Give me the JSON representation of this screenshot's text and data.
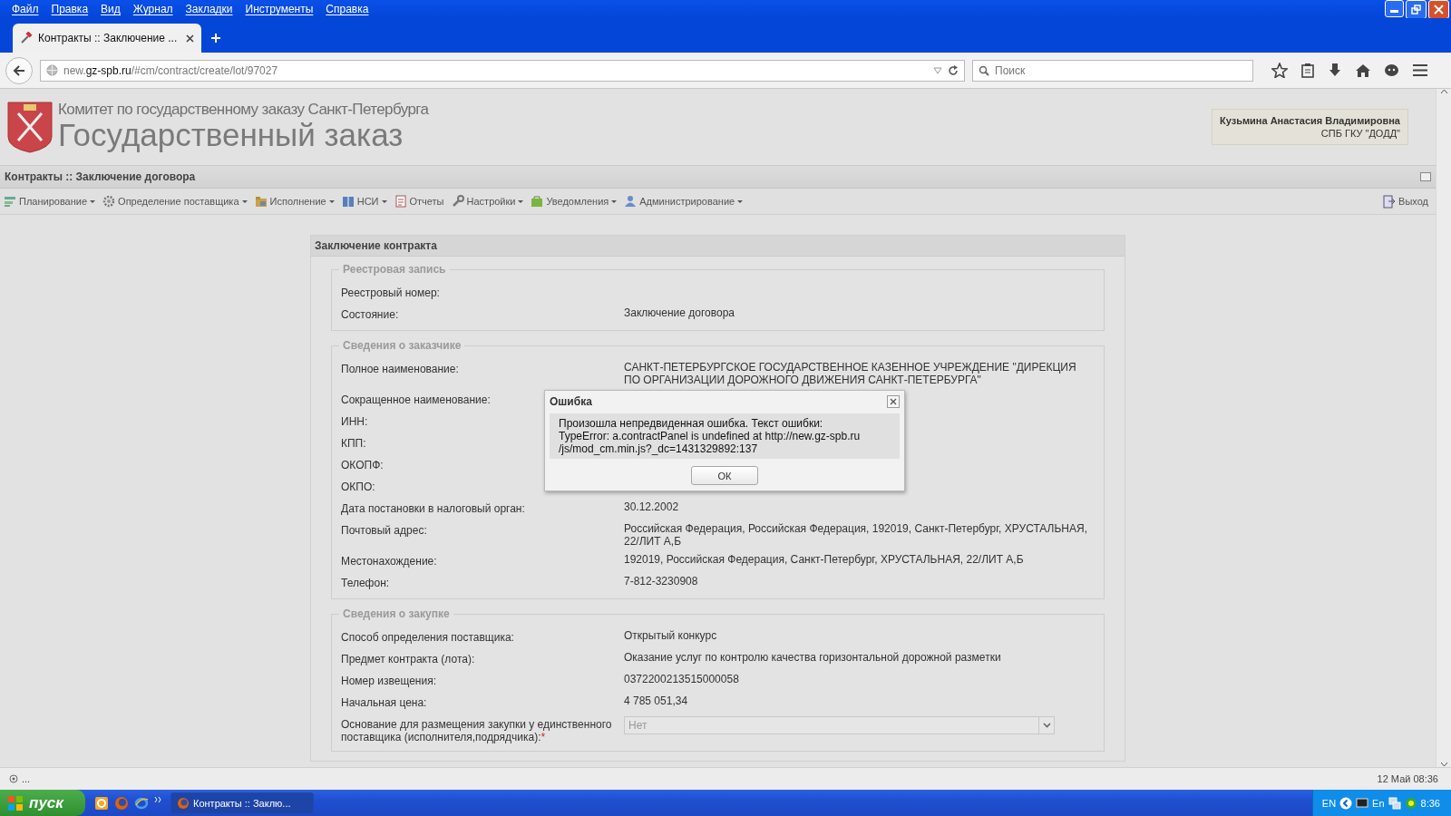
{
  "browser": {
    "menu": [
      "Файл",
      "Правка",
      "Вид",
      "Журнал",
      "Закладки",
      "Инструменты",
      "Справка"
    ],
    "tabs": [
      {
        "title": "Контракты :: Заключение ..."
      }
    ],
    "address": "new.**gz-spb.ru**/#cm/contract/create/lot/97027",
    "search": {
      "placeholder": "Поиск"
    }
  },
  "header": {
    "org": "Комитет по государственному заказу Санкт-Петербурга",
    "title": "Государственный заказ",
    "user": {
      "name": "Кузьмина Анастасия Владимировна",
      "org": "СПБ ГКУ \"ДОДД\""
    }
  },
  "panel": {
    "title": "Контракты :: Заключение договора"
  },
  "toolbar": {
    "items": [
      {
        "label": "Планирование",
        "kind": "plan",
        "dropdown": true
      },
      {
        "label": "Определение поставщика",
        "kind": "gears",
        "dropdown": true
      },
      {
        "label": "Исполнение",
        "kind": "folder",
        "dropdown": true
      },
      {
        "label": "НСИ",
        "kind": "book",
        "dropdown": true
      },
      {
        "label": "Отчеты",
        "kind": "report",
        "dropdown": false
      },
      {
        "label": "Настройки",
        "kind": "wrench",
        "dropdown": true
      },
      {
        "label": "Уведомления",
        "kind": "bag",
        "dropdown": true
      },
      {
        "label": "Администрирование",
        "kind": "user",
        "dropdown": true
      }
    ],
    "logout": "Выход"
  },
  "form": {
    "title": "Заключение контракта",
    "sections": [
      {
        "legend": "Реестровая запись",
        "fields": [
          {
            "label": "Реестровый номер:",
            "kind": "text"
          },
          {
            "label": "Состояние:",
            "kind": "text",
            "value": "Заключение договора"
          }
        ]
      },
      {
        "legend": "Сведения о заказчике",
        "fields": [
          {
            "label": "Полное наименование:",
            "kind": "text",
            "value": "САНКТ-ПЕТЕРБУРГСКОЕ ГОСУДАРСТВЕННОЕ КАЗЕННОЕ УЧРЕЖДЕНИЕ \"ДИРЕКЦИЯ ПО ОРГАНИЗАЦИИ ДОРОЖНОГО ДВИЖЕНИЯ САНКТ-ПЕТЕРБУРГА\""
          },
          {
            "label": "Сокращенное наименование:",
            "kind": "text"
          },
          {
            "label": "ИНН:",
            "kind": "text"
          },
          {
            "label": "КПП:",
            "kind": "text"
          },
          {
            "label": "ОКОПФ:",
            "kind": "text"
          },
          {
            "label": "ОКПО:",
            "kind": "text"
          },
          {
            "label": "Дата постановки в налоговый орган:",
            "kind": "text",
            "value": "30.12.2002"
          },
          {
            "label": "Почтовый адрес:",
            "kind": "text",
            "value": "Российская Федерация, Российская Федерация, 192019, Санкт-Петербург, ХРУСТАЛЬНАЯ, 22/ЛИТ А,Б"
          },
          {
            "label": "Местонахождение:",
            "kind": "text",
            "value": "192019, Российская Федерация, Санкт-Петербург, ХРУСТАЛЬНАЯ, 22/ЛИТ А,Б"
          },
          {
            "label": "Телефон:",
            "kind": "text",
            "value": "7-812-3230908"
          }
        ]
      },
      {
        "legend": "Сведения о закупке",
        "fields": [
          {
            "label": "Способ определения поставщика:",
            "kind": "text",
            "value": "Открытый конкурс"
          },
          {
            "label": "Предмет контракта (лота):",
            "kind": "text",
            "value": "Оказание услуг по контролю качества горизонтальной дорожной разметки"
          },
          {
            "label": "Номер извещения:",
            "kind": "text",
            "value": "0372200213515000058"
          },
          {
            "label": "Начальная цена:",
            "kind": "text",
            "value": "4 785 051,34"
          },
          {
            "label": "Основание для размещения закупки у единственного поставщика (исполнителя,подрядчика):",
            "kind": "combo",
            "required": true,
            "required_mark": "*",
            "value": "Нет",
            "disabled": true
          }
        ]
      }
    ]
  },
  "dialog": {
    "title": "Ошибка",
    "message": "Произошла непредвиденная ошибка. Текст ошибки:\nTypeError: a.contractPanel is undefined at http://new.gz-spb.ru\n/js/mod_cm.min.js?_dc=1431329892:137",
    "button": "ОК"
  },
  "status_bar": {
    "left": "...",
    "right": "12 Май 08:36"
  },
  "taskbar": {
    "start": "пуск",
    "windows": [
      {
        "title": "Контракты :: Заклю...",
        "selected": true
      }
    ],
    "tray": {
      "lang": "EN",
      "ime": "En",
      "time": "8:36"
    }
  }
}
